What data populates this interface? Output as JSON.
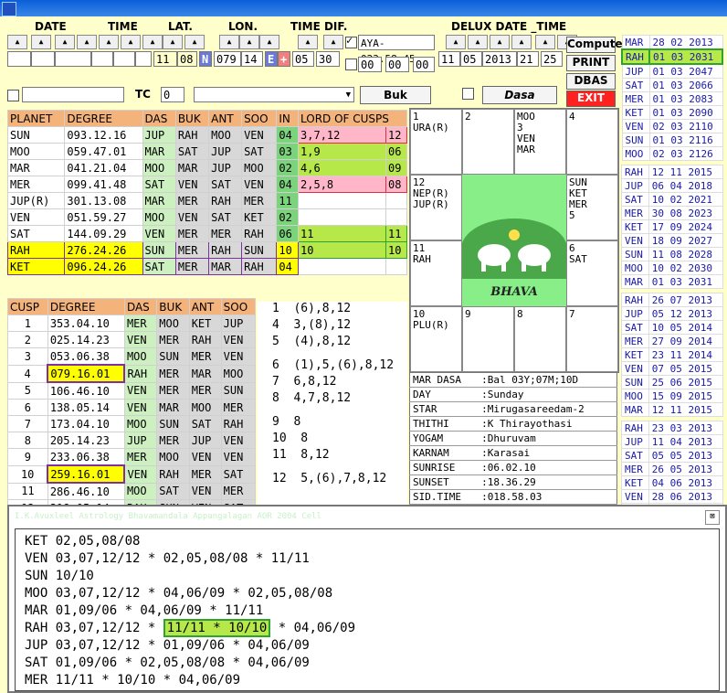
{
  "window": {
    "title": ""
  },
  "headers": {
    "date": "DATE",
    "time": "TIME",
    "lat": "LAT.",
    "lon": "LON.",
    "timedif": "TIME DIF.",
    "delux": "DELUX DATE _TIME"
  },
  "inputs": {
    "lat_deg": "11",
    "lat_min": "08",
    "lat_dir": "N",
    "lon_deg": "079",
    "lon_min": "14",
    "lon_dir": "E",
    "tz_sign": "+",
    "tz_h": "05",
    "tz_m": "30",
    "aya": "AYA-023.58.45",
    "z1": "00",
    "z2": "00",
    "z3": "00",
    "d_day": "11",
    "d_mon": "05",
    "d_year": "2013",
    "d_hour": "21",
    "d_min": "25",
    "tc_label": "TC",
    "tc_value": "0"
  },
  "buttons": {
    "compute": "Compute",
    "print": "PRINT",
    "dbas": "DBAS",
    "exit": "EXIT",
    "buk": "Buk",
    "dasa": "Dasa"
  },
  "planet_table": {
    "headers": [
      "PLANET",
      "DEGREE",
      "DAS",
      "BUK",
      "ANT",
      "SOO",
      "IN",
      "LORD OF CUSPS"
    ],
    "rows": [
      [
        "SUN",
        "093.12.16",
        "JUP",
        "RAH",
        "MOO",
        "VEN",
        "04",
        "3,7,12",
        "12"
      ],
      [
        "MOO",
        "059.47.01",
        "MAR",
        "SAT",
        "JUP",
        "SAT",
        "03",
        "1,9",
        "06"
      ],
      [
        "MAR",
        "041.21.04",
        "MOO",
        "MAR",
        "JUP",
        "MOO",
        "02",
        "4,6",
        "09"
      ],
      [
        "MER",
        "099.41.48",
        "SAT",
        "VEN",
        "SAT",
        "VEN",
        "04",
        "2,5,8",
        "08"
      ],
      [
        "JUP(R)",
        "301.13.08",
        "MAR",
        "MER",
        "RAH",
        "MER",
        "11",
        "",
        ""
      ],
      [
        "VEN",
        "051.59.27",
        "MOO",
        "VEN",
        "SAT",
        "KET",
        "02",
        "",
        ""
      ],
      [
        "SAT",
        "144.09.29",
        "VEN",
        "MER",
        "MER",
        "RAH",
        "06",
        "11",
        "11"
      ],
      [
        "RAH",
        "276.24.26",
        "SUN",
        "MER",
        "RAH",
        "SUN",
        "10",
        "10",
        "10"
      ],
      [
        "KET",
        "096.24.26",
        "SAT",
        "MER",
        "MAR",
        "RAH",
        "04",
        "",
        ""
      ]
    ]
  },
  "cusp_table": {
    "headers": [
      "CUSP",
      "DEGREE",
      "DAS",
      "BUK",
      "ANT",
      "SOO"
    ],
    "rows": [
      [
        "1",
        "353.04.10",
        "MER",
        "MOO",
        "KET",
        "JUP"
      ],
      [
        "2",
        "025.14.23",
        "VEN",
        "MER",
        "RAH",
        "VEN"
      ],
      [
        "3",
        "053.06.38",
        "MOO",
        "SUN",
        "MER",
        "VEN"
      ],
      [
        "4",
        "079.16.01",
        "RAH",
        "MER",
        "MAR",
        "MOO"
      ],
      [
        "5",
        "106.46.10",
        "VEN",
        "MER",
        "MER",
        "SUN"
      ],
      [
        "6",
        "138.05.14",
        "VEN",
        "MAR",
        "MOO",
        "MER"
      ],
      [
        "7",
        "173.04.10",
        "MOO",
        "SUN",
        "SAT",
        "RAH"
      ],
      [
        "8",
        "205.14.23",
        "JUP",
        "MER",
        "JUP",
        "VEN"
      ],
      [
        "9",
        "233.06.38",
        "MER",
        "MOO",
        "VEN",
        "VEN"
      ],
      [
        "10",
        "259.16.01",
        "VEN",
        "RAH",
        "MER",
        "SAT"
      ],
      [
        "11",
        "286.46.10",
        "MOO",
        "SAT",
        "VEN",
        "MER"
      ],
      [
        "12",
        "318.05.14",
        "RAH",
        "SUN",
        "VEN",
        "SAT"
      ]
    ]
  },
  "cusp_sig": [
    "1  (6),8,12",
    "4  3,(8),12",
    "5  (4),8,12",
    "6  (1),5,(6),8,12",
    "7  6,8,12",
    "8  4,7,8,12",
    "9  8",
    "10  8",
    "11  8,12",
    "12  5,(6),7,8,12"
  ],
  "chart": {
    "cells": [
      "1\nURA(R)",
      "2",
      "MOO\n3\nVEN\nMAR",
      "4",
      "12\nNEP(R)\nJUP(R)",
      "SUN\nKET\nMER\n5",
      "11\nRAH",
      "6\nSAT",
      "10\nPLU(R)",
      "9",
      "8",
      "7"
    ],
    "center": "BHAVA"
  },
  "info": [
    [
      "MAR DASA",
      ":Bal 03Y;07M;10D"
    ],
    [
      "DAY",
      ":Sunday"
    ],
    [
      "STAR",
      ":Mirugasareedam-2"
    ],
    [
      "THITHI",
      ":K Thirayothasi"
    ],
    [
      "YOGAM",
      ":Dhuruvam"
    ],
    [
      "KARNAM",
      ":Karasai"
    ],
    [
      "SUNRISE",
      ":06.02.10"
    ],
    [
      "SUNSET",
      ":18.36.29"
    ],
    [
      "SID.TIME",
      ":018.58.03"
    ]
  ],
  "side_list": [
    [
      [
        "MAR",
        "28 02 2013"
      ],
      [
        "RAH",
        "01 03 2031"
      ],
      [
        "JUP",
        "01 03 2047"
      ],
      [
        "SAT",
        "01 03 2066"
      ],
      [
        "MER",
        "01 03 2083"
      ],
      [
        "KET",
        "01 03 2090"
      ],
      [
        "VEN",
        "02 03 2110"
      ],
      [
        "SUN",
        "01 03 2116"
      ],
      [
        "MOO",
        "02 03 2126"
      ]
    ],
    [
      [
        "RAH",
        "12 11 2015"
      ],
      [
        "JUP",
        "06 04 2018"
      ],
      [
        "SAT",
        "10 02 2021"
      ],
      [
        "MER",
        "30 08 2023"
      ],
      [
        "KET",
        "17 09 2024"
      ],
      [
        "VEN",
        "18 09 2027"
      ],
      [
        "SUN",
        "11 08 2028"
      ],
      [
        "MOO",
        "10 02 2030"
      ],
      [
        "MAR",
        "01 03 2031"
      ]
    ],
    [
      [
        "RAH",
        "26 07 2013"
      ],
      [
        "JUP",
        "05 12 2013"
      ],
      [
        "SAT",
        "10 05 2014"
      ],
      [
        "MER",
        "27 09 2014"
      ],
      [
        "KET",
        "23 11 2014"
      ],
      [
        "VEN",
        "07 05 2015"
      ],
      [
        "SUN",
        "25 06 2015"
      ],
      [
        "MOO",
        "15 09 2015"
      ],
      [
        "MAR",
        "12 11 2015"
      ]
    ],
    [
      [
        "RAH",
        "23 03 2013"
      ],
      [
        "JUP",
        "11 04 2013"
      ],
      [
        "SAT",
        "05 05 2013"
      ],
      [
        "MER",
        "26 05 2013"
      ],
      [
        "KET",
        "04 06 2013"
      ],
      [
        "VEN",
        "28 06 2013"
      ],
      [
        "SUN",
        "05 07 2013"
      ],
      [
        "MOO",
        "18 07 2013"
      ],
      [
        "MAR",
        "26 07 2013"
      ]
    ]
  ],
  "bottom": {
    "heading": "I.K.Avuxleel Astrology Bhavamandala Appangalagan AOR 2004  Cell",
    "lines": [
      "KET 02,05,08/08",
      "VEN 03,07,12/12 * 02,05,08/08 * 11/11",
      "SUN 10/10",
      "MOO 03,07,12/12 * 04,06/09 * 02,05,08/08",
      "MAR 01,09/06 * 04,06/09 * 11/11",
      "RAH 03,07,12/12 * ",
      "JUP 03,07,12/12 * 01,09/06 * 04,06/09",
      "SAT 01,09/06 * 02,05,08/08 * 04,06/09",
      "MER 11/11 * 10/10 * 04,06/09"
    ],
    "rah_highlight": "11/11 * 10/10",
    "rah_tail": " * 04,06/09"
  },
  "colors": {
    "bg": "#ffffcc",
    "header": "#f4b37a",
    "green": "#ccf0c0",
    "gray": "#d8d8d8",
    "highlight": "#b6e84a"
  }
}
